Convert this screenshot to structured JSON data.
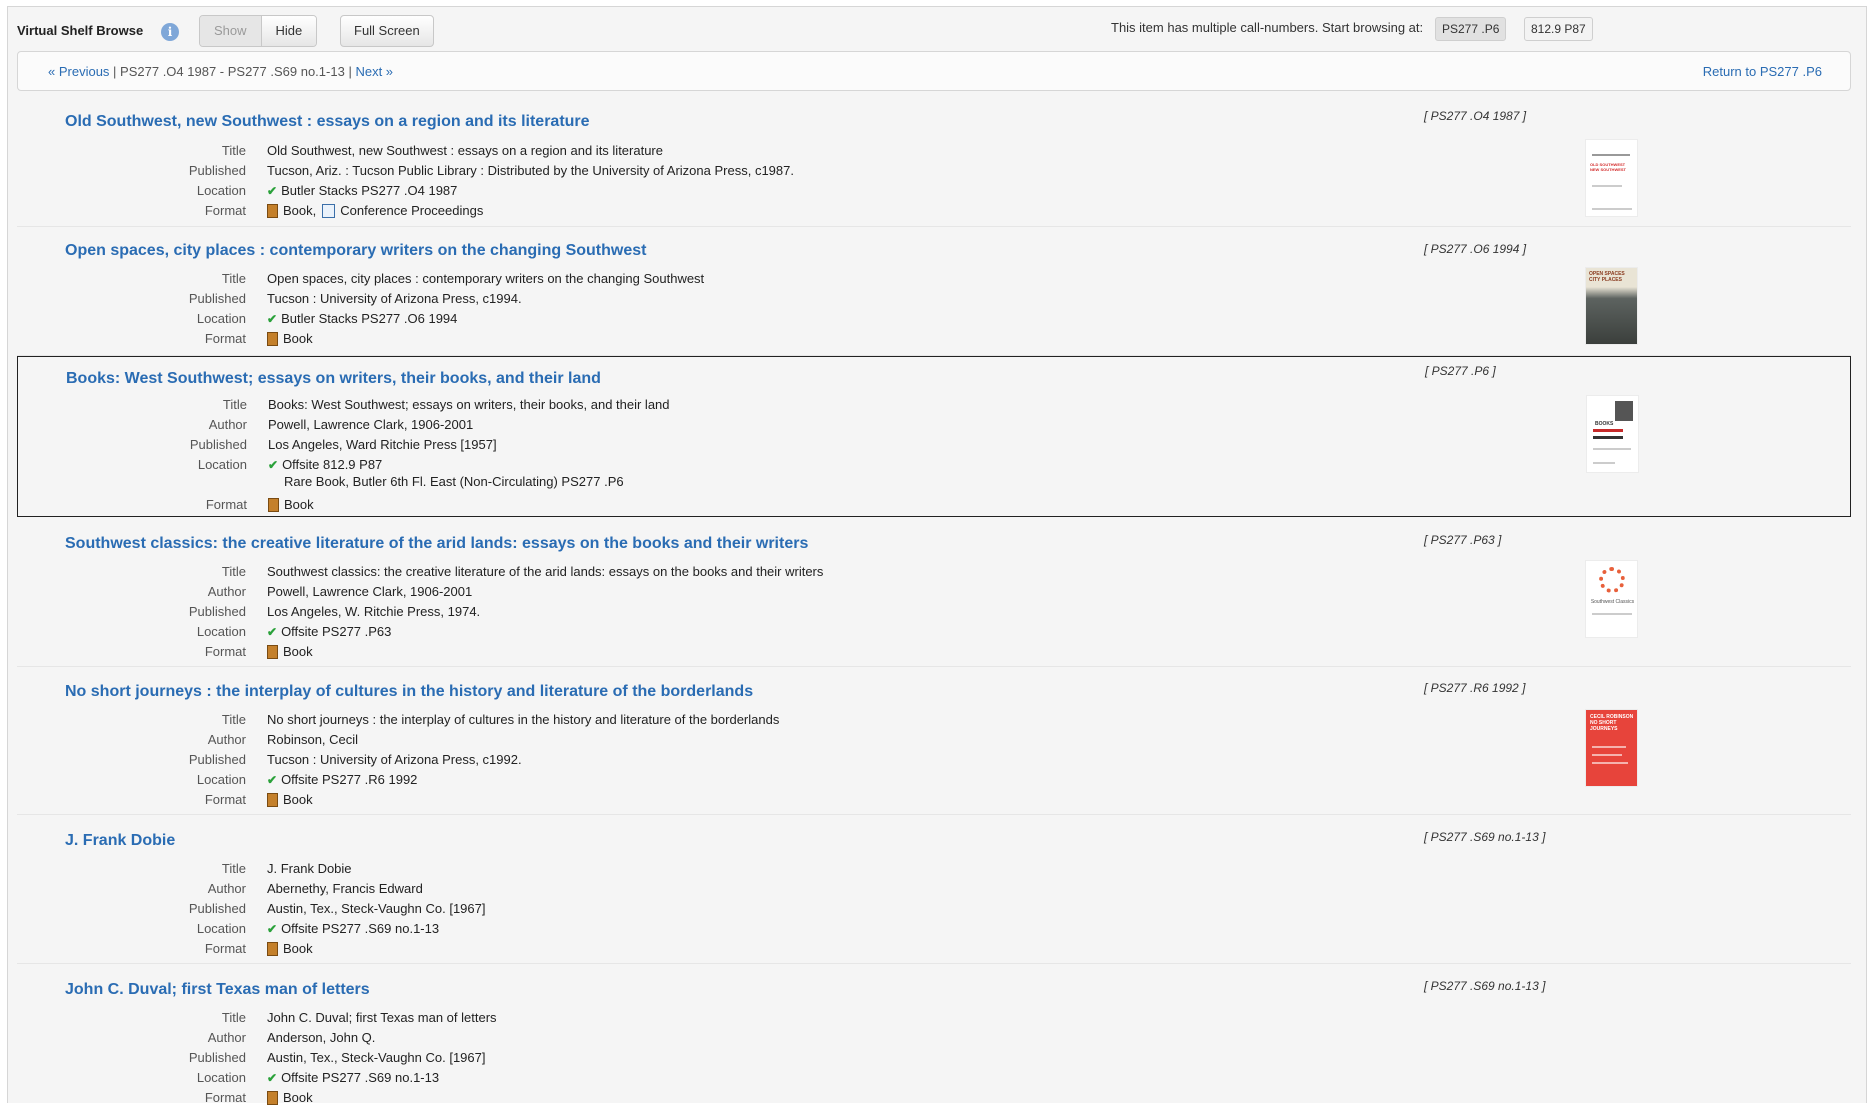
{
  "toolbar": {
    "title": "Virtual Shelf Browse",
    "info_glyph": "i",
    "show_label": "Show",
    "hide_label": "Hide",
    "fullscreen_label": "Full Screen",
    "multi_message": "This item has multiple call-numbers. Start browsing at:",
    "callnumber_options": [
      "PS277 .P6",
      "812.9 P87"
    ],
    "selected_callnumber": "PS277 .P6"
  },
  "nav": {
    "previous_label": "« Previous",
    "range": "PS277 .O4 1987 - PS277 .S69 no.1-13",
    "next_label": "Next »",
    "return_label": "Return to PS277 .P6"
  },
  "field_labels": {
    "title": "Title",
    "author": "Author",
    "published": "Published",
    "location": "Location",
    "format": "Format"
  },
  "records": [
    {
      "heading": "Old Southwest, new Southwest : essays on a region and its literature",
      "call_number": "[ PS277 .O4 1987 ]",
      "title": "Old Southwest, new Southwest : essays on a region and its literature",
      "published": "Tucson, Ariz. : Tucson Public Library : Distributed by the University of Arizona Press, c1987.",
      "location": "Butler Stacks PS277 .O4 1987",
      "format": "Book,",
      "format_extra": "Conference Proceedings",
      "cover_text": "OLD SOUTHWEST NEW SOUTHWEST"
    },
    {
      "heading": "Open spaces, city places : contemporary writers on the changing Southwest",
      "call_number": "[ PS277 .O6 1994 ]",
      "title": "Open spaces, city places : contemporary writers on the changing Southwest",
      "published": "Tucson : University of Arizona Press, c1994.",
      "location": "Butler Stacks PS277 .O6 1994",
      "format": "Book",
      "cover_text": "OPEN SPACES CITY PLACES"
    },
    {
      "heading": "Books: West Southwest; essays on writers, their books, and their land",
      "call_number": "[ PS277 .P6 ]",
      "title": "Books: West Southwest; essays on writers, their books, and their land",
      "author": "Powell, Lawrence Clark, 1906-2001",
      "published": "Los Angeles, Ward Ritchie Press [1957]",
      "location": "Offsite 812.9 P87",
      "location_extra": "Rare Book, Butler 6th Fl. East (Non-Circulating) PS277 .P6",
      "format": "Book",
      "cover_text": "BOOKS"
    },
    {
      "heading": "Southwest classics: the creative literature of the arid lands: essays on the books and their writers",
      "call_number": "[ PS277 .P63 ]",
      "title": "Southwest classics: the creative literature of the arid lands: essays on the books and their writers",
      "author": "Powell, Lawrence Clark, 1906-2001",
      "published": "Los Angeles, W. Ritchie Press, 1974.",
      "location": "Offsite PS277 .P63",
      "format": "Book",
      "cover_text": "Southwest Classics"
    },
    {
      "heading": "No short journeys : the interplay of cultures in the history and literature of the borderlands",
      "call_number": "[ PS277 .R6 1992 ]",
      "title": "No short journeys : the interplay of cultures in the history and literature of the borderlands",
      "author": "Robinson, Cecil",
      "published": "Tucson : University of Arizona Press, c1992.",
      "location": "Offsite PS277 .R6 1992",
      "format": "Book",
      "cover_text": "CECIL ROBINSON NO SHORT JOURNEYS"
    },
    {
      "heading": "J. Frank Dobie",
      "call_number": "[ PS277 .S69 no.1-13 ]",
      "title": "J. Frank Dobie",
      "author": "Abernethy, Francis Edward",
      "published": "Austin, Tex., Steck-Vaughn Co. [1967]",
      "location": "Offsite PS277 .S69 no.1-13",
      "format": "Book"
    },
    {
      "heading": "John C. Duval; first Texas man of letters",
      "call_number": "[ PS277 .S69 no.1-13 ]",
      "title": "John C. Duval; first Texas man of letters",
      "author": "Anderson, John Q.",
      "published": "Austin, Tex., Steck-Vaughn Co. [1967]",
      "location": "Offsite PS277 .S69 no.1-13",
      "format": "Book"
    }
  ],
  "colors": {
    "link": "#2a6cb3",
    "available_check": "#2aa13a"
  }
}
